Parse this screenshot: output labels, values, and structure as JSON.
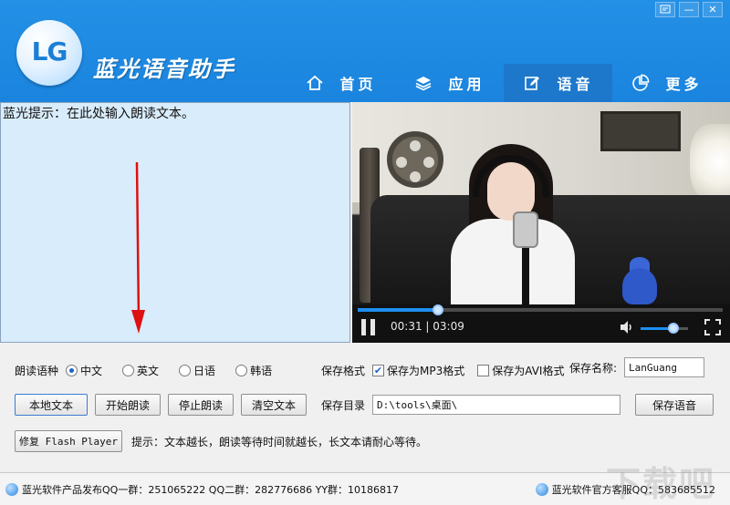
{
  "app": {
    "logo_text": "LG",
    "title": "蓝光语音助手"
  },
  "window": {
    "settings_icon": "settings-icon",
    "minimize_label": "—",
    "close_label": "✕"
  },
  "nav": [
    {
      "label": "首页",
      "icon": "home-icon",
      "active": false
    },
    {
      "label": "应用",
      "icon": "layers-icon",
      "active": false
    },
    {
      "label": "语音",
      "icon": "edit-icon",
      "active": true
    },
    {
      "label": "更多",
      "icon": "pie-chart-icon",
      "active": false
    }
  ],
  "editor": {
    "hint_text": "蓝光提示：在此处输入朗读文本。"
  },
  "video": {
    "time_current": "00:31",
    "time_total": "03:09",
    "progress": 0.22,
    "volume": 0.7
  },
  "panel": {
    "voice_label": "朗读语种",
    "voices": [
      "中文",
      "英文",
      "日语",
      "韩语"
    ],
    "voice_selected": "中文",
    "buttons": {
      "local_text": "本地文本",
      "start_reading": "开始朗读",
      "stop_reading": "停止朗读",
      "clear_text": "清空文本",
      "fix_flash": "修复 Flash Player",
      "save_voice": "保存语音"
    },
    "save_format_label": "保存格式",
    "format_mp3": "保存为MP3格式",
    "format_mp3_checked": true,
    "format_avi": "保存为AVI格式",
    "format_avi_checked": false,
    "save_name_label": "保存名称:",
    "save_name_value": "LanGuang",
    "save_dir_label": "保存目录",
    "save_dir_value": "D:\\tools\\桌面\\",
    "tip_text": "提示：文本越长，朗读等待时间就越长，长文本请耐心等待。"
  },
  "status": {
    "left_text": "蓝光软件产品发布QQ一群：251065222 QQ二群：282776686 YY群：10186817",
    "right_text": "蓝光软件官方客服QQ：583685512"
  },
  "watermark": "下载吧"
}
